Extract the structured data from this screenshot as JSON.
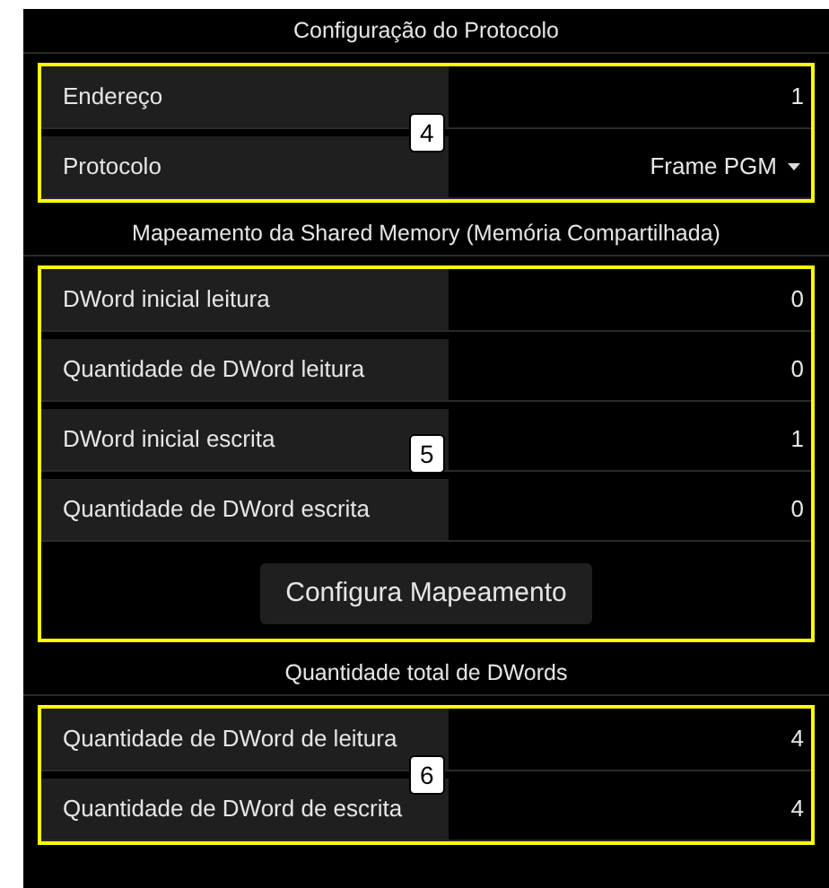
{
  "sections": [
    {
      "title": "Configuração do Protocolo",
      "callout": "4",
      "rows": [
        {
          "kind": "text",
          "label": "Endereço",
          "value": "1"
        },
        {
          "kind": "select",
          "label": "Protocolo",
          "value": "Frame PGM"
        }
      ]
    },
    {
      "title": "Mapeamento da Shared Memory (Memória Compartilhada)",
      "callout": "5",
      "rows": [
        {
          "kind": "text",
          "label": "DWord inicial leitura",
          "value": "0"
        },
        {
          "kind": "text",
          "label": "Quantidade de DWord leitura",
          "value": "0"
        },
        {
          "kind": "text",
          "label": "DWord inicial escrita",
          "value": "1"
        },
        {
          "kind": "text",
          "label": "Quantidade de DWord escrita",
          "value": "0"
        }
      ],
      "button": "Configura Mapeamento"
    },
    {
      "title": "Quantidade total de DWords",
      "callout": "6",
      "rows": [
        {
          "kind": "text",
          "label": "Quantidade de DWord de leitura",
          "value": "4"
        },
        {
          "kind": "text",
          "label": "Quantidade de DWord de escrita",
          "value": "4"
        }
      ]
    }
  ]
}
